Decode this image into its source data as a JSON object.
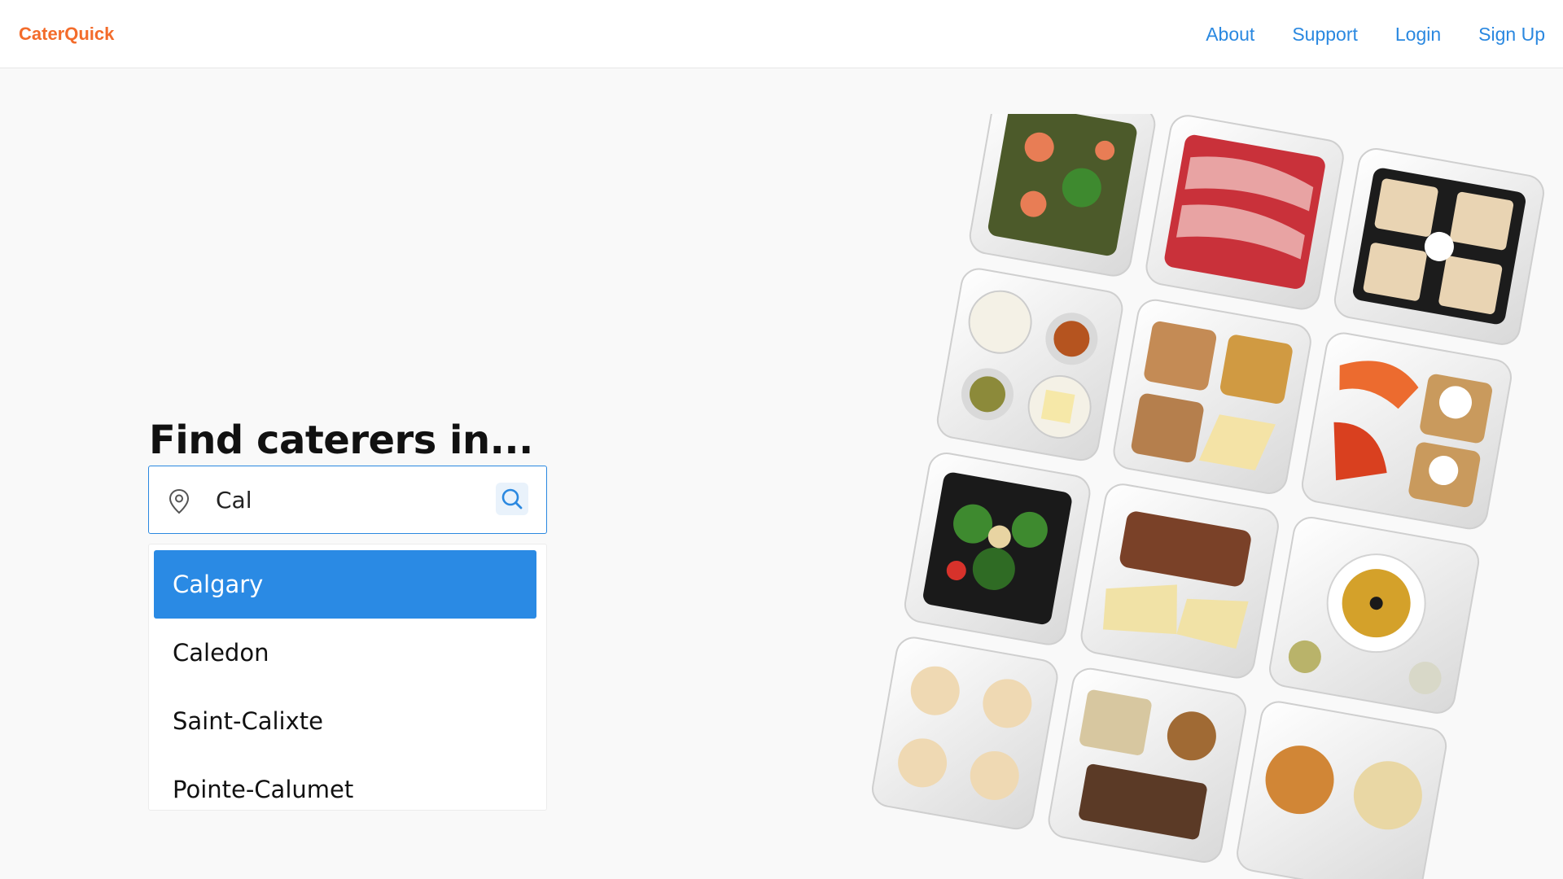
{
  "header": {
    "brand": "CaterQuick",
    "nav": [
      {
        "label": "About"
      },
      {
        "label": "Support"
      },
      {
        "label": "Login"
      },
      {
        "label": "Sign Up"
      }
    ]
  },
  "hero": {
    "title": "Find caterers in..."
  },
  "search": {
    "value": "Cal",
    "suggestions": [
      {
        "label": "Calgary",
        "selected": true
      },
      {
        "label": "Caledon",
        "selected": false
      },
      {
        "label": "Saint-Calixte",
        "selected": false
      },
      {
        "label": "Pointe-Calumet",
        "selected": false
      }
    ]
  },
  "colors": {
    "brand": "#f36c2b",
    "accent": "#2a88e0",
    "selected_bg": "#2a8ae4",
    "page_bg": "#f9f9f9"
  },
  "icons": {
    "location": "map-pin-icon",
    "search": "magnifier-icon"
  },
  "image": {
    "subject": "catering trays food illustration"
  }
}
